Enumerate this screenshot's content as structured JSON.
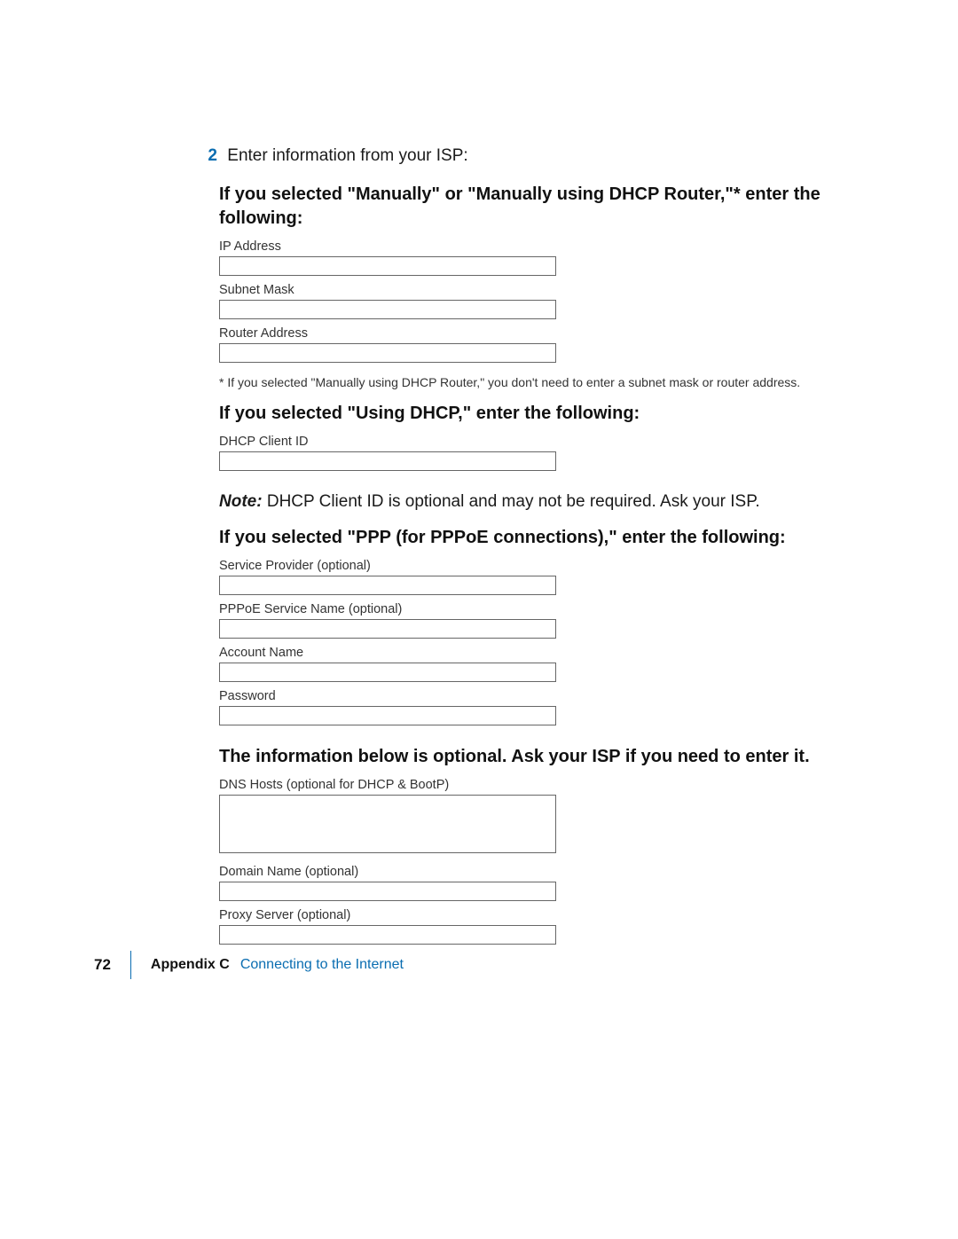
{
  "step": {
    "number": "2",
    "text": "Enter information from your ISP:"
  },
  "sections": {
    "manual": {
      "heading": "If you selected \"Manually\" or \"Manually using DHCP Router,\"* enter the following:",
      "fields": {
        "ip_address": {
          "label": "IP Address",
          "value": ""
        },
        "subnet_mask": {
          "label": "Subnet Mask",
          "value": ""
        },
        "router_address": {
          "label": "Router Address",
          "value": ""
        }
      },
      "footnote": "* If you selected \"Manually using DHCP Router,\" you don't need to enter a subnet mask or router address."
    },
    "dhcp": {
      "heading": "If you selected \"Using DHCP,\" enter the following:",
      "fields": {
        "dhcp_client_id": {
          "label": "DHCP Client ID",
          "value": ""
        }
      },
      "note_label": "Note:",
      "note_body": "  DHCP Client ID is optional and may not be required. Ask your ISP."
    },
    "ppp": {
      "heading": "If you selected \"PPP (for PPPoE connections),\" enter the following:",
      "fields": {
        "service_provider": {
          "label": "Service Provider (optional)",
          "value": ""
        },
        "pppoe_service_name": {
          "label": "PPPoE Service Name (optional)",
          "value": ""
        },
        "account_name": {
          "label": "Account Name",
          "value": ""
        },
        "password": {
          "label": "Password",
          "value": ""
        }
      }
    },
    "optional": {
      "heading": "The information below is optional. Ask your ISP if you need to enter it.",
      "fields": {
        "dns_hosts": {
          "label": "DNS Hosts (optional for DHCP & BootP)",
          "value": ""
        },
        "domain_name": {
          "label": "Domain Name (optional)",
          "value": ""
        },
        "proxy_server": {
          "label": "Proxy Server (optional)",
          "value": ""
        }
      }
    }
  },
  "footer": {
    "page_number": "72",
    "appendix": "Appendix C",
    "title": "Connecting to the Internet"
  }
}
